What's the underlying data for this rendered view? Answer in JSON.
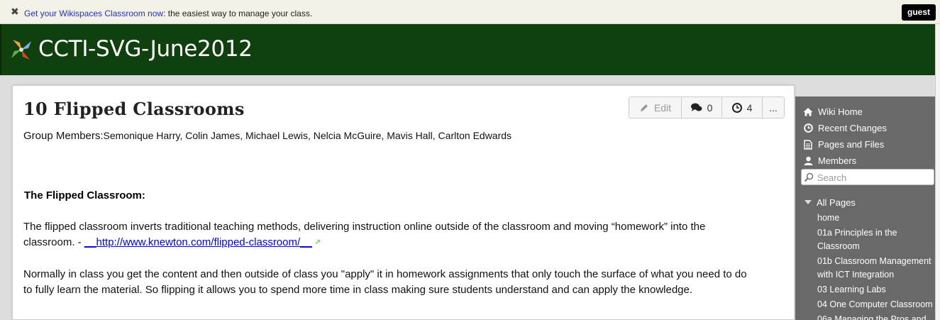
{
  "promo": {
    "link_text": "Get your Wikispaces Classroom now",
    "rest_text": ": the easiest way to manage your class."
  },
  "user": {
    "label": "guest"
  },
  "site": {
    "title": "CCTI-SVG-June2012"
  },
  "page": {
    "title": "10 Flipped Classrooms",
    "toolbar": {
      "edit_label": "Edit",
      "comments_count": "0",
      "history_count": "4",
      "more_label": "..."
    },
    "group_members_label": "Group Members:",
    "group_members_value": "Semonique Harry, Colin James, Michael Lewis, Nelcia McGuire, Mavis Hall, Carlton Edwards",
    "section_heading": "The Flipped Classroom:",
    "p1_text": "The flipped classroom inverts traditional teaching methods, delivering instruction online outside of the classroom and moving “homework” into the classroom. - ",
    "p1_link": "__http://www.knewton.com/flipped-classroom/__",
    "p2_text": "Normally in class you get the content and then outside of class you \"apply\" it in homework assignments that only touch the surface of what you need to do to fully learn the material. So flipping it allows you to spend more time in class making sure students understand and can apply the knowledge."
  },
  "sidebar": {
    "nav": [
      {
        "label": "Wiki Home",
        "icon": "home-icon"
      },
      {
        "label": "Recent Changes",
        "icon": "clock-icon"
      },
      {
        "label": "Pages and Files",
        "icon": "document-icon"
      },
      {
        "label": "Members",
        "icon": "user-icon"
      }
    ],
    "search_placeholder": "Search",
    "all_pages_label": "All Pages",
    "pages": [
      "home",
      "01a Principles in the Classroom",
      "01b Classroom Management with ICT Integration",
      "03 Learning Labs",
      "04 One Computer Classroom",
      "06a Managing the Pros and"
    ]
  },
  "colors": {
    "header_bg": "#11400f",
    "sidebar_bg": "#696969",
    "promo_bg": "#f3f1e6",
    "link": "#0000dd"
  }
}
